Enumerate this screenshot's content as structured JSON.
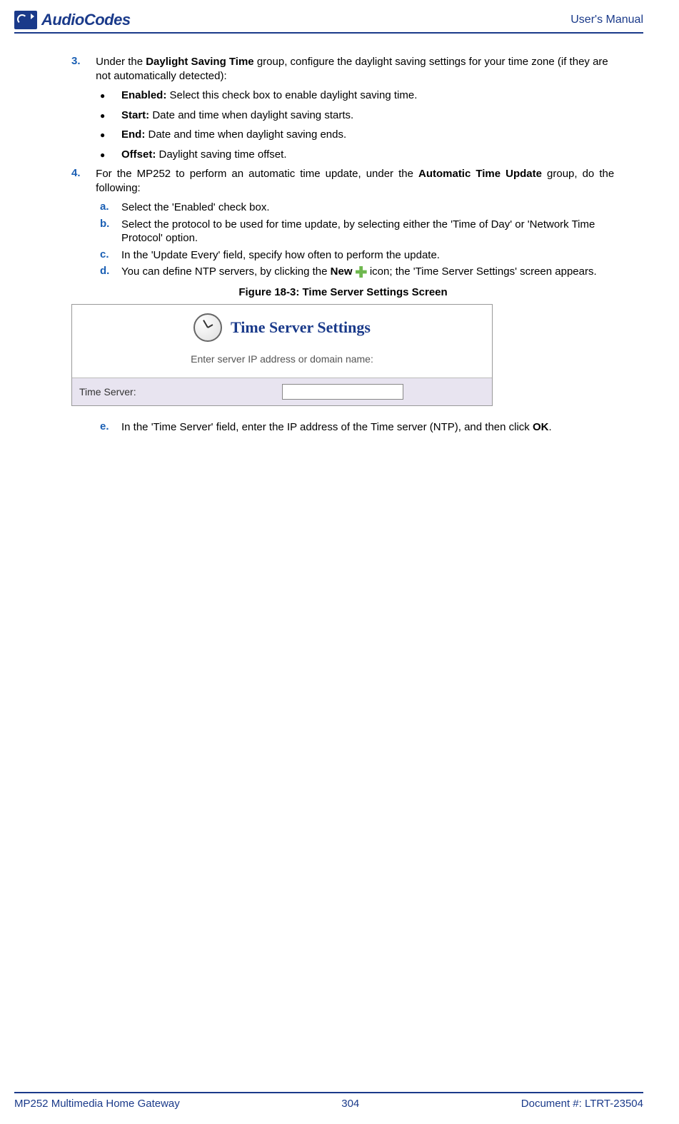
{
  "header": {
    "logo_text": "AudioCodes",
    "right_text": "User's Manual"
  },
  "step3": {
    "num": "3.",
    "text_before": "Under the ",
    "bold1": "Daylight Saving Time",
    "text_after": " group, configure the daylight saving settings for your time zone (if they are not automatically detected):"
  },
  "bullets": [
    {
      "label": "Enabled:",
      "text": " Select this check box to enable daylight saving time."
    },
    {
      "label": "Start:",
      "text": " Date and time when daylight saving starts."
    },
    {
      "label": "End:",
      "text": " Date and time when daylight saving ends."
    },
    {
      "label": "Offset:",
      "text": " Daylight saving time offset."
    }
  ],
  "step4": {
    "num": "4.",
    "text_before": "For the MP252 to perform an automatic time update, under the ",
    "bold1": "Automatic Time Update",
    "text_after": " group, do the following:"
  },
  "substeps": {
    "a": {
      "label": "a.",
      "text": "Select the 'Enabled' check box."
    },
    "b": {
      "label": "b.",
      "text": "Select the protocol to be used for time update, by selecting either the 'Time of Day' or 'Network Time Protocol' option."
    },
    "c": {
      "label": "c.",
      "text": "In the 'Update Every' field, specify how often to perform the update."
    },
    "d": {
      "label": "d.",
      "text_before": "You can define NTP servers, by clicking the ",
      "bold": "New",
      "text_after": " icon; the 'Time Server Settings' screen appears."
    },
    "e": {
      "label": "e.",
      "text_before": "In the 'Time Server' field, enter the IP address of the Time server (NTP), and then click ",
      "bold": "OK",
      "text_after": "."
    }
  },
  "figure": {
    "caption": "Figure 18-3: Time Server Settings Screen",
    "title": "Time Server Settings",
    "subtitle": "Enter server IP address or domain name:",
    "row_label": "Time Server:"
  },
  "footer": {
    "left": "MP252 Multimedia Home Gateway",
    "center": "304",
    "right": "Document #: LTRT-23504"
  }
}
